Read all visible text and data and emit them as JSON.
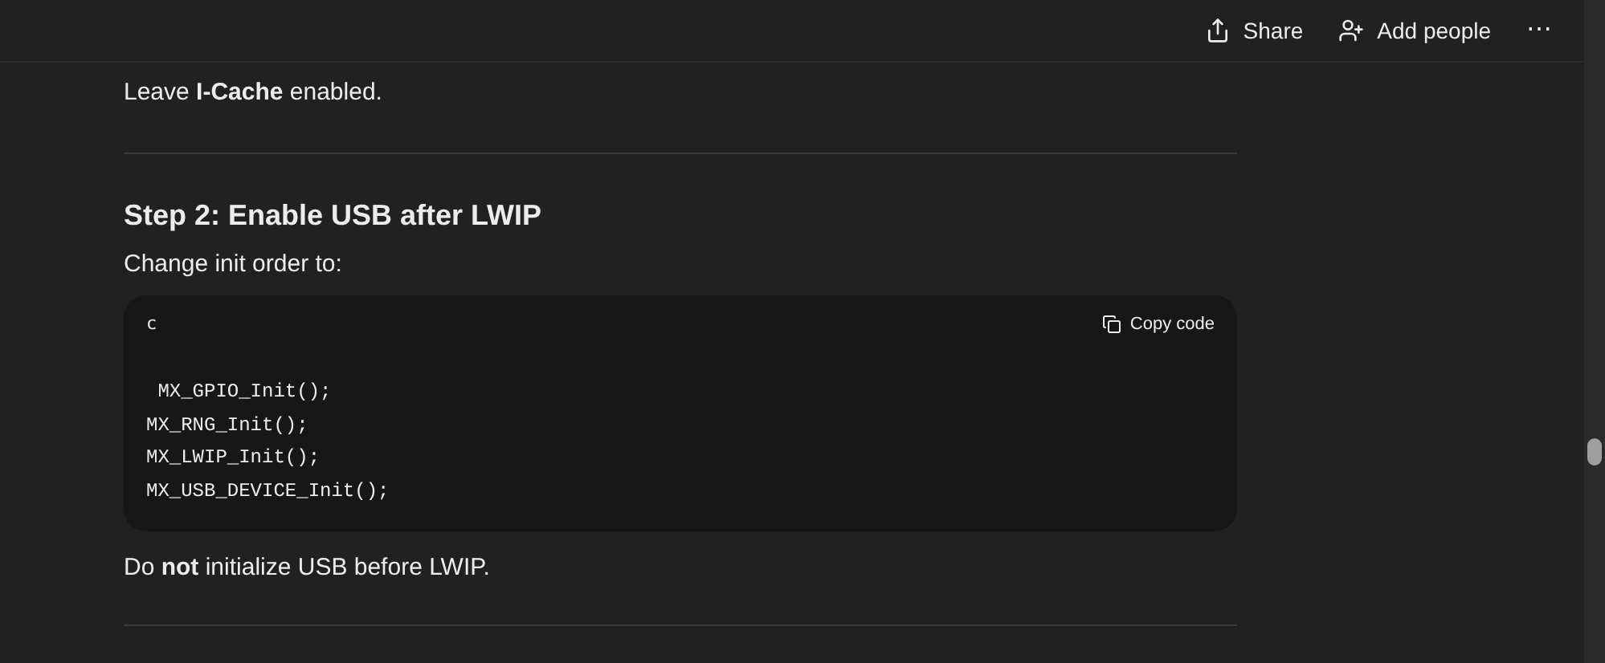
{
  "top_bar": {
    "share": "Share",
    "add_people": "Add people",
    "more": "⋯"
  },
  "content": {
    "intro": "Leave **I-Cache** enabled.",
    "heading": "Step 2: Enable USB after LWIP",
    "lead": "Change init order to:",
    "code_block": {
      "language": "c",
      "copy": "Copy code",
      "lines": [
        " MX_GPIO_Init();",
        "MX_RNG_Init();",
        "MX_LWIP_Init();",
        "MX_USB_DEVICE_Init();"
      ]
    },
    "note": "Do **not** initialize USB before LWIP."
  }
}
